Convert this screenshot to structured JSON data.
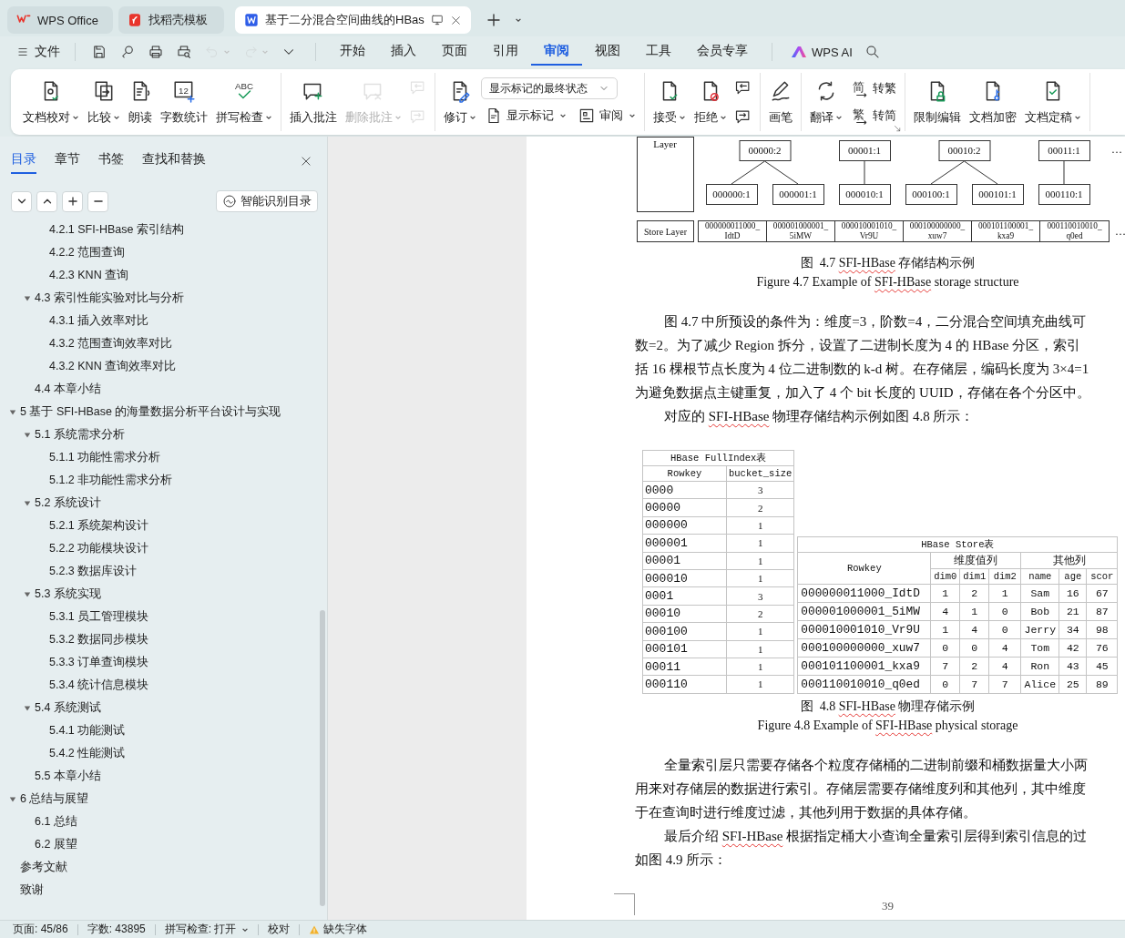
{
  "tabs": [
    {
      "label": "WPS Office",
      "selected": false
    },
    {
      "label": "找稻壳模板",
      "selected": false
    },
    {
      "label": "基于二分混合空间曲线的HBas",
      "selected": true
    }
  ],
  "menu": {
    "file": "文件",
    "quick_actions": [
      {
        "disabled": false,
        "dropdown": false
      },
      {
        "disabled": false,
        "dropdown": false
      },
      {
        "disabled": false,
        "dropdown": false
      },
      {
        "disabled": false,
        "dropdown": false
      },
      {
        "disabled": true,
        "dropdown": true
      },
      {
        "disabled": true,
        "dropdown": true
      },
      {
        "disabled": false,
        "dropdown": false
      }
    ],
    "items": [
      {
        "label": "开始",
        "selected": false
      },
      {
        "label": "插入",
        "selected": false
      },
      {
        "label": "页面",
        "selected": false
      },
      {
        "label": "引用",
        "selected": false
      },
      {
        "label": "审阅",
        "selected": true
      },
      {
        "label": "视图",
        "selected": false
      },
      {
        "label": "工具",
        "selected": false
      },
      {
        "label": "会员专享",
        "selected": false
      }
    ],
    "ai": "WPS AI"
  },
  "ribbon": {
    "groups": [
      {
        "items": [
          {
            "kind": "large",
            "label": "文档校对",
            "dropdown": true,
            "disabled": false
          },
          {
            "kind": "large",
            "label": "比较",
            "dropdown": true,
            "disabled": false
          },
          {
            "kind": "large",
            "label": "朗读",
            "dropdown": false,
            "disabled": false
          },
          {
            "kind": "large",
            "label": "字数统计",
            "icon_text": "12",
            "dropdown": false,
            "disabled": false
          },
          {
            "kind": "large",
            "label": "拼写检查",
            "icon_text": "ABC",
            "dropdown": true,
            "disabled": false
          }
        ]
      },
      {
        "items": [
          {
            "kind": "large",
            "label": "插入批注",
            "dropdown": false,
            "disabled": false
          },
          {
            "kind": "large",
            "label": "删除批注",
            "dropdown": true,
            "disabled": true
          },
          {
            "kind": "stack",
            "items": [
              {
                "kind": "icon",
                "disabled": true
              },
              {
                "kind": "icon",
                "disabled": true
              }
            ]
          }
        ]
      },
      {
        "items": [
          {
            "kind": "large",
            "label": "修订",
            "dropdown": true,
            "disabled": false
          },
          {
            "kind": "stack",
            "items": [
              {
                "kind": "select",
                "value": "显示标记的最终状态"
              },
              {
                "kind": "row",
                "items": [
                  {
                    "kind": "small",
                    "label": "显示标记",
                    "dropdown": true,
                    "disabled": false
                  },
                  {
                    "kind": "small",
                    "label": "审阅",
                    "dropdown": true,
                    "disabled": false
                  }
                ]
              }
            ]
          }
        ]
      },
      {
        "items": [
          {
            "kind": "large",
            "label": "接受",
            "dropdown": true,
            "disabled": false
          },
          {
            "kind": "large",
            "label": "拒绝",
            "dropdown": true,
            "disabled": false
          },
          {
            "kind": "stack",
            "items": [
              {
                "kind": "icon",
                "disabled": false
              },
              {
                "kind": "icon",
                "disabled": false
              }
            ]
          }
        ]
      },
      {
        "items": [
          {
            "kind": "large",
            "label": "画笔",
            "dropdown": false,
            "disabled": false
          }
        ]
      },
      {
        "dialog_launcher": true,
        "items": [
          {
            "kind": "large",
            "label": "翻译",
            "dropdown": true,
            "disabled": false
          },
          {
            "kind": "stack",
            "items": [
              {
                "kind": "small",
                "glyph": "简",
                "label": "转繁",
                "dropdown": false,
                "disabled": false
              },
              {
                "kind": "small",
                "glyph": "繁",
                "label": "转简",
                "dropdown": false,
                "disabled": false
              }
            ]
          }
        ]
      },
      {
        "items": [
          {
            "kind": "large",
            "label": "限制编辑",
            "dropdown": false,
            "disabled": false
          },
          {
            "kind": "large",
            "label": "文档加密",
            "dropdown": false,
            "disabled": false
          },
          {
            "kind": "large",
            "label": "文档定稿",
            "dropdown": true,
            "disabled": false
          }
        ]
      }
    ]
  },
  "sidebar": {
    "tabs": [
      {
        "label": "目录",
        "selected": true
      },
      {
        "label": "章节",
        "selected": false
      },
      {
        "label": "书签",
        "selected": false
      },
      {
        "label": "查找和替换",
        "selected": false
      }
    ],
    "smart_button": "智能识别目录",
    "toc": [
      {
        "children": [
          {
            "children": [
              {
                "label": "4.2.1 SFI-HBase 索引结构"
              },
              {
                "label": "4.2.2  范围查询"
              },
              {
                "label": "4.2.3 KNN 查询"
              }
            ]
          },
          {
            "label": "4.3 索引性能实验对比与分析",
            "expanded": true,
            "children": [
              {
                "label": "4.3.1  插入效率对比"
              },
              {
                "label": "4.3.2  范围查询效率对比"
              },
              {
                "label": "4.3.2 KNN 查询效率对比"
              }
            ]
          },
          {
            "label": "4.4  本章小结"
          }
        ]
      },
      {
        "label": "5  基于 SFI-HBase 的海量数据分析平台设计与实现",
        "expanded": true,
        "children": [
          {
            "label": "5.1  系统需求分析",
            "expanded": true,
            "children": [
              {
                "label": "5.1.1  功能性需求分析"
              },
              {
                "label": "5.1.2  非功能性需求分析"
              }
            ]
          },
          {
            "label": "5.2  系统设计",
            "expanded": true,
            "children": [
              {
                "label": "5.2.1  系统架构设计"
              },
              {
                "label": "5.2.2  功能模块设计"
              },
              {
                "label": "5.2.3  数据库设计"
              }
            ]
          },
          {
            "label": "5.3 系统实现",
            "expanded": true,
            "children": [
              {
                "label": "5.3.1  员工管理模块"
              },
              {
                "label": "5.3.2  数据同步模块"
              },
              {
                "label": "5.3.3  订单查询模块"
              },
              {
                "label": "5.3.4  统计信息模块"
              }
            ]
          },
          {
            "label": "5.4  系统测试",
            "expanded": true,
            "children": [
              {
                "label": "5.4.1  功能测试"
              },
              {
                "label": "5.4.2  性能测试"
              }
            ]
          },
          {
            "label": "5.5  本章小结"
          }
        ]
      },
      {
        "label": "6  总结与展望",
        "expanded": true,
        "children": [
          {
            "label": "6.1  总结"
          },
          {
            "label": "6.2  展望"
          }
        ]
      },
      {
        "label": "参考文献"
      },
      {
        "label": "致谢"
      }
    ]
  },
  "document": {
    "blocks": [
      {
        "kind": "diagram",
        "index_label": "Layer",
        "index_nodes": [
          {
            "label": "00000:2",
            "children": [
              {
                "label": "000000:1"
              },
              {
                "label": "000001:1"
              }
            ]
          },
          {
            "label": "00001:1",
            "children": [
              {
                "label": "000010:1"
              }
            ]
          },
          {
            "label": "00010:2",
            "children": [
              {
                "label": "000100:1"
              },
              {
                "label": "000101:1"
              }
            ]
          },
          {
            "label": "00011:1",
            "children": [
              {
                "label": "000110:1"
              }
            ]
          }
        ],
        "index_more": "…",
        "store_label": "Store Layer",
        "store_cells": [
          "000000011000_\nIdtD",
          "000001000001_\n5iMW",
          "000010001010_\nVr9U",
          "000100000000_\nxuw7",
          "000101100001_\nkxa9",
          "000110010010_\nq0ed"
        ],
        "store_more": "…"
      },
      {
        "kind": "caption",
        "segments": [
          {
            "text": "图  4.7 ",
            "spell_error": false
          },
          {
            "text": "SFI-HBase",
            "spell_error": true
          },
          {
            "text": " 存储结构示例",
            "spell_error": false
          }
        ]
      },
      {
        "kind": "caption",
        "segments": [
          {
            "text": "Figure 4.7 Example of ",
            "spell_error": false
          },
          {
            "text": "SFI-HBase",
            "spell_error": true
          },
          {
            "text": " storage structure",
            "spell_error": false
          }
        ]
      },
      {
        "kind": "line",
        "indent": true,
        "segments": [
          {
            "text": "图 4.7 中所预设的条件为：维度=3，阶数=4，二分混合空间填充曲线可",
            "spell_error": false
          }
        ]
      },
      {
        "kind": "line",
        "indent": false,
        "segments": [
          {
            "text": "数=2。为了减少 Region 拆分，设置了二进制长度为 4 的 HBase 分区，索引",
            "spell_error": false
          }
        ]
      },
      {
        "kind": "line",
        "indent": false,
        "segments": [
          {
            "text": "括 16 棵根节点长度为 4 位二进制数的 k-d 树。在存储层，编码长度为 3×4=1",
            "spell_error": false
          }
        ]
      },
      {
        "kind": "line",
        "indent": false,
        "segments": [
          {
            "text": "为避免数据点主键重复，加入了 4 个 bit 长度的 UUID，存储在各个分区中。",
            "spell_error": false
          }
        ]
      },
      {
        "kind": "line",
        "indent": true,
        "segments": [
          {
            "text": "对应的 ",
            "spell_error": false
          },
          {
            "text": "SFI-HBase",
            "spell_error": true
          },
          {
            "text": " 物理存储结构示例如图 4.8 所示：",
            "spell_error": false
          }
        ]
      },
      {
        "kind": "tables",
        "full_index": {
          "title": "HBase FullIndex表",
          "columns": [
            "Rowkey",
            "bucket_size"
          ],
          "rows": [
            [
              "0000",
              "3"
            ],
            [
              "00000",
              "2"
            ],
            [
              "000000",
              "1"
            ],
            [
              "000001",
              "1"
            ],
            [
              "00001",
              "1"
            ],
            [
              "000010",
              "1"
            ],
            [
              "0001",
              "3"
            ],
            [
              "00010",
              "2"
            ],
            [
              "000100",
              "1"
            ],
            [
              "000101",
              "1"
            ],
            [
              "00011",
              "1"
            ],
            [
              "000110",
              "1"
            ]
          ]
        },
        "store": {
          "title": "HBase Store表",
          "key_column": "Rowkey",
          "column_groups": [
            {
              "label": "维度值列",
              "columns": [
                "dim0",
                "dim1",
                "dim2"
              ]
            },
            {
              "label": "其他列",
              "columns": [
                "name",
                "age",
                "scor"
              ]
            }
          ],
          "rows": [
            [
              "000000011000_IdtD",
              "1",
              "2",
              "1",
              "Sam",
              "16",
              "67"
            ],
            [
              "000001000001_5iMW",
              "4",
              "1",
              "0",
              "Bob",
              "21",
              "87"
            ],
            [
              "000010001010_Vr9U",
              "1",
              "4",
              "0",
              "Jerry",
              "34",
              "98"
            ],
            [
              "000100000000_xuw7",
              "0",
              "0",
              "4",
              "Tom",
              "42",
              "76"
            ],
            [
              "000101100001_kxa9",
              "7",
              "2",
              "4",
              "Ron",
              "43",
              "45"
            ],
            [
              "000110010010_q0ed",
              "0",
              "7",
              "7",
              "Alice",
              "25",
              "89"
            ]
          ]
        }
      },
      {
        "kind": "caption",
        "segments": [
          {
            "text": "图  4.8 ",
            "spell_error": false
          },
          {
            "text": "SFI-HBase",
            "spell_error": true
          },
          {
            "text": " 物理存储示例",
            "spell_error": false
          }
        ]
      },
      {
        "kind": "caption",
        "segments": [
          {
            "text": "Figure 4.8 Example of ",
            "spell_error": false
          },
          {
            "text": "SFI-HBase",
            "spell_error": true
          },
          {
            "text": " physical storage",
            "spell_error": false
          }
        ]
      },
      {
        "kind": "line",
        "indent": true,
        "segments": [
          {
            "text": "全量索引层只需要存储各个粒度存储桶的二进制前缀和桶数据量大小两",
            "spell_error": false
          }
        ]
      },
      {
        "kind": "line",
        "indent": false,
        "segments": [
          {
            "text": "用来对存储层的数据进行索引。存储层需要存储维度列和其他列，其中维度",
            "spell_error": false
          }
        ]
      },
      {
        "kind": "line",
        "indent": false,
        "segments": [
          {
            "text": "于在查询时进行维度过滤，其他列用于数据的具体存储。",
            "spell_error": false
          }
        ]
      },
      {
        "kind": "line",
        "indent": true,
        "segments": [
          {
            "text": "最后介绍 ",
            "spell_error": false
          },
          {
            "text": "SFI-HBase",
            "spell_error": true
          },
          {
            "text": " 根据指定桶大小查询全量索引层得到索引信息的过",
            "spell_error": false
          }
        ]
      },
      {
        "kind": "line",
        "indent": false,
        "segments": [
          {
            "text": "如图 4.9 所示：",
            "spell_error": false
          }
        ]
      }
    ],
    "page_number": "39"
  },
  "status_bar": [
    {
      "kind": "text",
      "label": "页面: 45/86",
      "dropdown": false
    },
    {
      "kind": "text",
      "label": "字数: 43895",
      "dropdown": false
    },
    {
      "kind": "text",
      "label": "拼写检查: 打开",
      "dropdown": true
    },
    {
      "kind": "text",
      "label": "校对",
      "dropdown": false
    },
    {
      "kind": "warning",
      "label": "缺失字体",
      "dropdown": false
    }
  ]
}
